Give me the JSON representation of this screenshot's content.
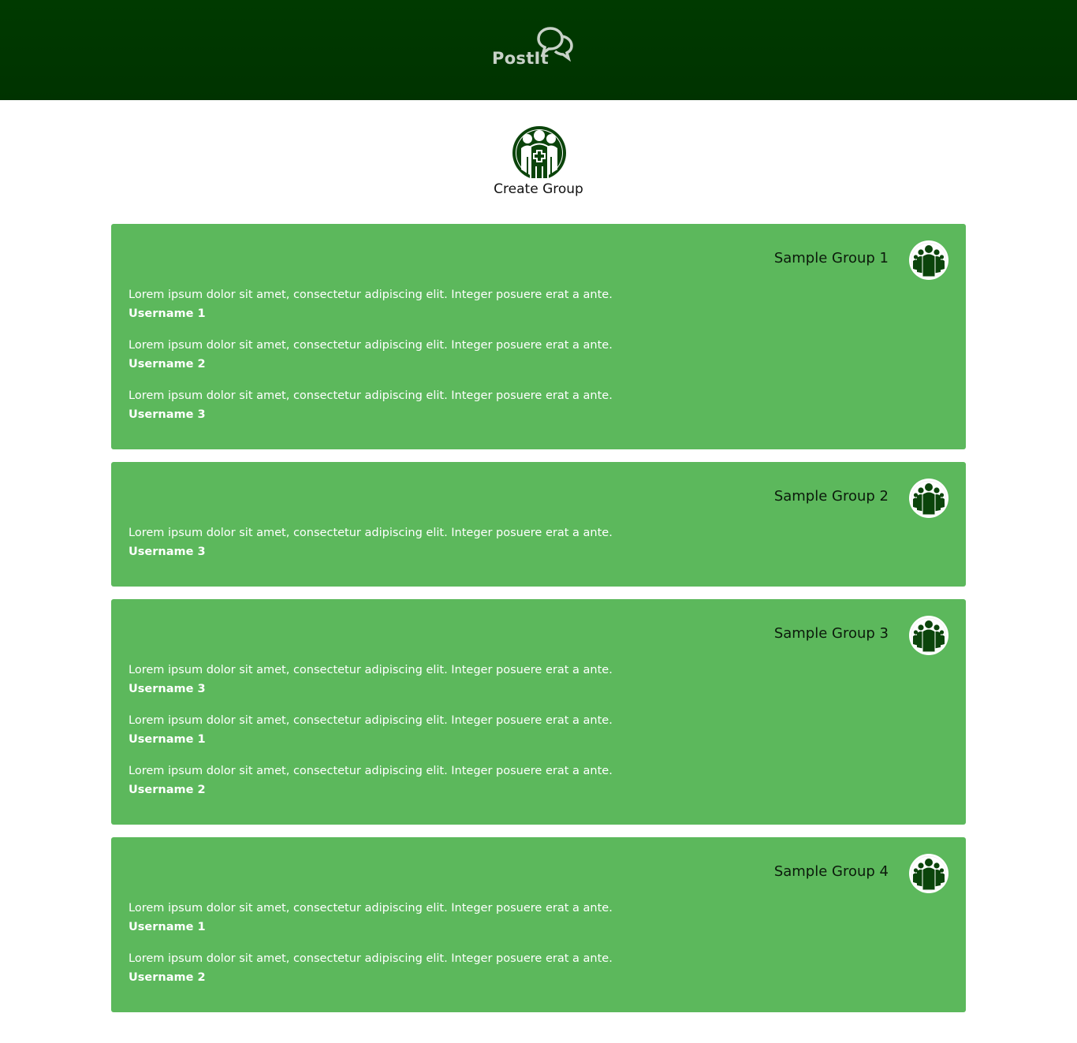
{
  "header": {
    "brand": "PostIt",
    "logo_icon": "speech-bubbles-icon"
  },
  "create_group": {
    "label": "Create Group",
    "icon": "add-group-icon"
  },
  "colors": {
    "header_bg": "#003a00",
    "card_bg": "#5cb85c",
    "icon_dark": "#0b440b"
  },
  "groups": [
    {
      "title": "Sample Group 1",
      "posts": [
        {
          "text": "Lorem ipsum dolor sit amet, consectetur adipiscing elit. Integer posuere erat a ante.",
          "user": "Username 1"
        },
        {
          "text": "Lorem ipsum dolor sit amet, consectetur adipiscing elit. Integer posuere erat a ante.",
          "user": "Username 2"
        },
        {
          "text": "Lorem ipsum dolor sit amet, consectetur adipiscing elit. Integer posuere erat a ante.",
          "user": "Username 3"
        }
      ]
    },
    {
      "title": "Sample Group 2",
      "posts": [
        {
          "text": "Lorem ipsum dolor sit amet, consectetur adipiscing elit. Integer posuere erat a ante.",
          "user": "Username 3"
        }
      ]
    },
    {
      "title": "Sample Group 3",
      "posts": [
        {
          "text": "Lorem ipsum dolor sit amet, consectetur adipiscing elit. Integer posuere erat a ante.",
          "user": "Username 3"
        },
        {
          "text": "Lorem ipsum dolor sit amet, consectetur adipiscing elit. Integer posuere erat a ante.",
          "user": "Username 1"
        },
        {
          "text": "Lorem ipsum dolor sit amet, consectetur adipiscing elit. Integer posuere erat a ante.",
          "user": "Username 2"
        }
      ]
    },
    {
      "title": "Sample Group 4",
      "posts": [
        {
          "text": "Lorem ipsum dolor sit amet, consectetur adipiscing elit. Integer posuere erat a ante.",
          "user": "Username 1"
        },
        {
          "text": "Lorem ipsum dolor sit amet, consectetur adipiscing elit. Integer posuere erat a ante.",
          "user": "Username 2"
        }
      ]
    }
  ]
}
